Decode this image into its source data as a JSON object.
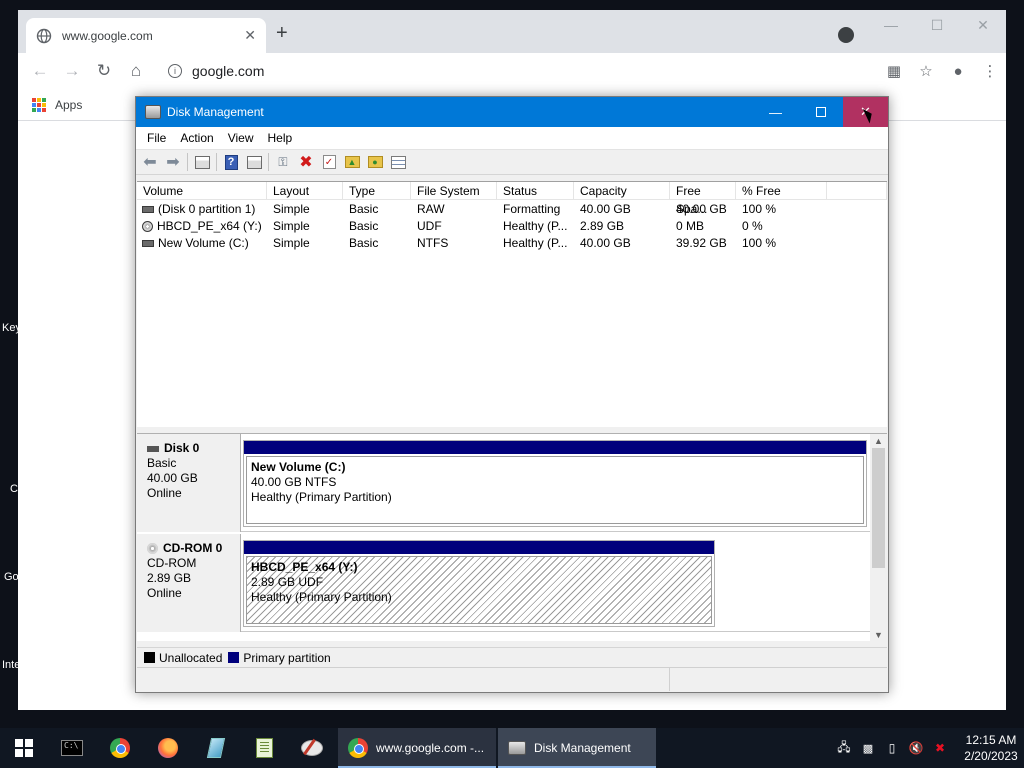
{
  "desktop": {
    "labels": [
      "Key",
      "C",
      "Go",
      "Inte"
    ]
  },
  "browser": {
    "tab_title": "www.google.com",
    "address": "google.com",
    "bookmark_apps": "Apps",
    "colors": {
      "tabbar": "#dee1e6",
      "apps_grid": [
        "#ea4335",
        "#fbbc04",
        "#34a853",
        "#4285f4",
        "#ea4335",
        "#fbbc04",
        "#34a853",
        "#4285f4",
        "#ea4335"
      ]
    }
  },
  "disk_management": {
    "title": "Disk Management",
    "menu": [
      "File",
      "Action",
      "View",
      "Help"
    ],
    "toolbar_icons": [
      "back-arrow-icon",
      "forward-arrow-icon",
      "properties-icon",
      "help-icon",
      "console-icon",
      "connect-icon",
      "delete-icon",
      "check-icon",
      "folder-up-icon",
      "folder-search-icon",
      "list-view-icon"
    ],
    "columns": [
      "Volume",
      "Layout",
      "Type",
      "File System",
      "Status",
      "Capacity",
      "Free Spa...",
      "% Free",
      ""
    ],
    "volumes": [
      {
        "icon": "drive-icon",
        "volume": "(Disk 0 partition 1)",
        "layout": "Simple",
        "type": "Basic",
        "fs": "RAW",
        "status": "Formatting",
        "capacity": "40.00 GB",
        "free": "40.00 GB",
        "pct": "100 %"
      },
      {
        "icon": "cdrom-icon",
        "volume": "HBCD_PE_x64 (Y:)",
        "layout": "Simple",
        "type": "Basic",
        "fs": "UDF",
        "status": "Healthy (P...",
        "capacity": "2.89 GB",
        "free": "0 MB",
        "pct": "0 %"
      },
      {
        "icon": "drive-icon",
        "volume": "New Volume (C:)",
        "layout": "Simple",
        "type": "Basic",
        "fs": "NTFS",
        "status": "Healthy (P...",
        "capacity": "40.00 GB",
        "free": "39.92 GB",
        "pct": "100 %"
      }
    ],
    "disks": [
      {
        "name": "Disk 0",
        "kind": "Basic",
        "size": "40.00 GB",
        "state": "Online",
        "partition": {
          "name": "New Volume  (C:)",
          "detail": "40.00 GB NTFS",
          "status": "Healthy (Primary Partition)"
        }
      },
      {
        "name": "CD-ROM 0",
        "kind": "CD-ROM",
        "size": "2.89 GB",
        "state": "Online",
        "partition": {
          "name": "HBCD_PE_x64  (Y:)",
          "detail": "2.89 GB UDF",
          "status": "Healthy (Primary Partition)"
        }
      }
    ],
    "legend": [
      {
        "label": "Unallocated",
        "color": "#000000"
      },
      {
        "label": "Primary partition",
        "color": "#00007c"
      }
    ]
  },
  "taskbar": {
    "apps": [
      {
        "label": "www.google.com -..."
      },
      {
        "label": "Disk Management"
      }
    ],
    "time": "12:15 AM",
    "date": "2/20/2023"
  }
}
